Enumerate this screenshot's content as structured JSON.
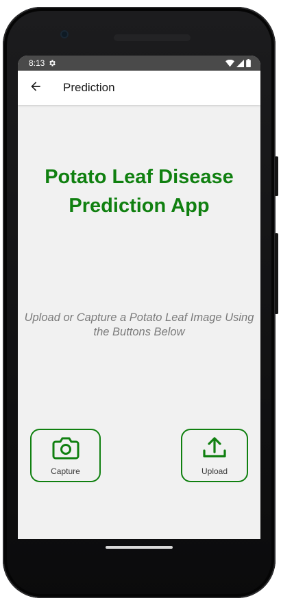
{
  "status_bar": {
    "time": "8:13",
    "icons": [
      "settings-gear-icon",
      "wifi-icon",
      "cellular-signal-icon",
      "battery-icon"
    ]
  },
  "app_bar": {
    "back_icon": "arrow-back-icon",
    "title": "Prediction"
  },
  "main": {
    "headline": "Potato Leaf Disease Prediction App",
    "subtitle": "Upload or Capture a Potato Leaf Image Using the Buttons Below"
  },
  "buttons": {
    "capture": {
      "label": "Capture",
      "icon": "camera-icon"
    },
    "upload": {
      "label": "Upload",
      "icon": "upload-icon"
    }
  },
  "colors": {
    "accent_green": "#108010",
    "screen_background": "#f1f1f1",
    "status_bar": "#4a4a4a",
    "subtitle_gray": "#7a7a7a"
  }
}
